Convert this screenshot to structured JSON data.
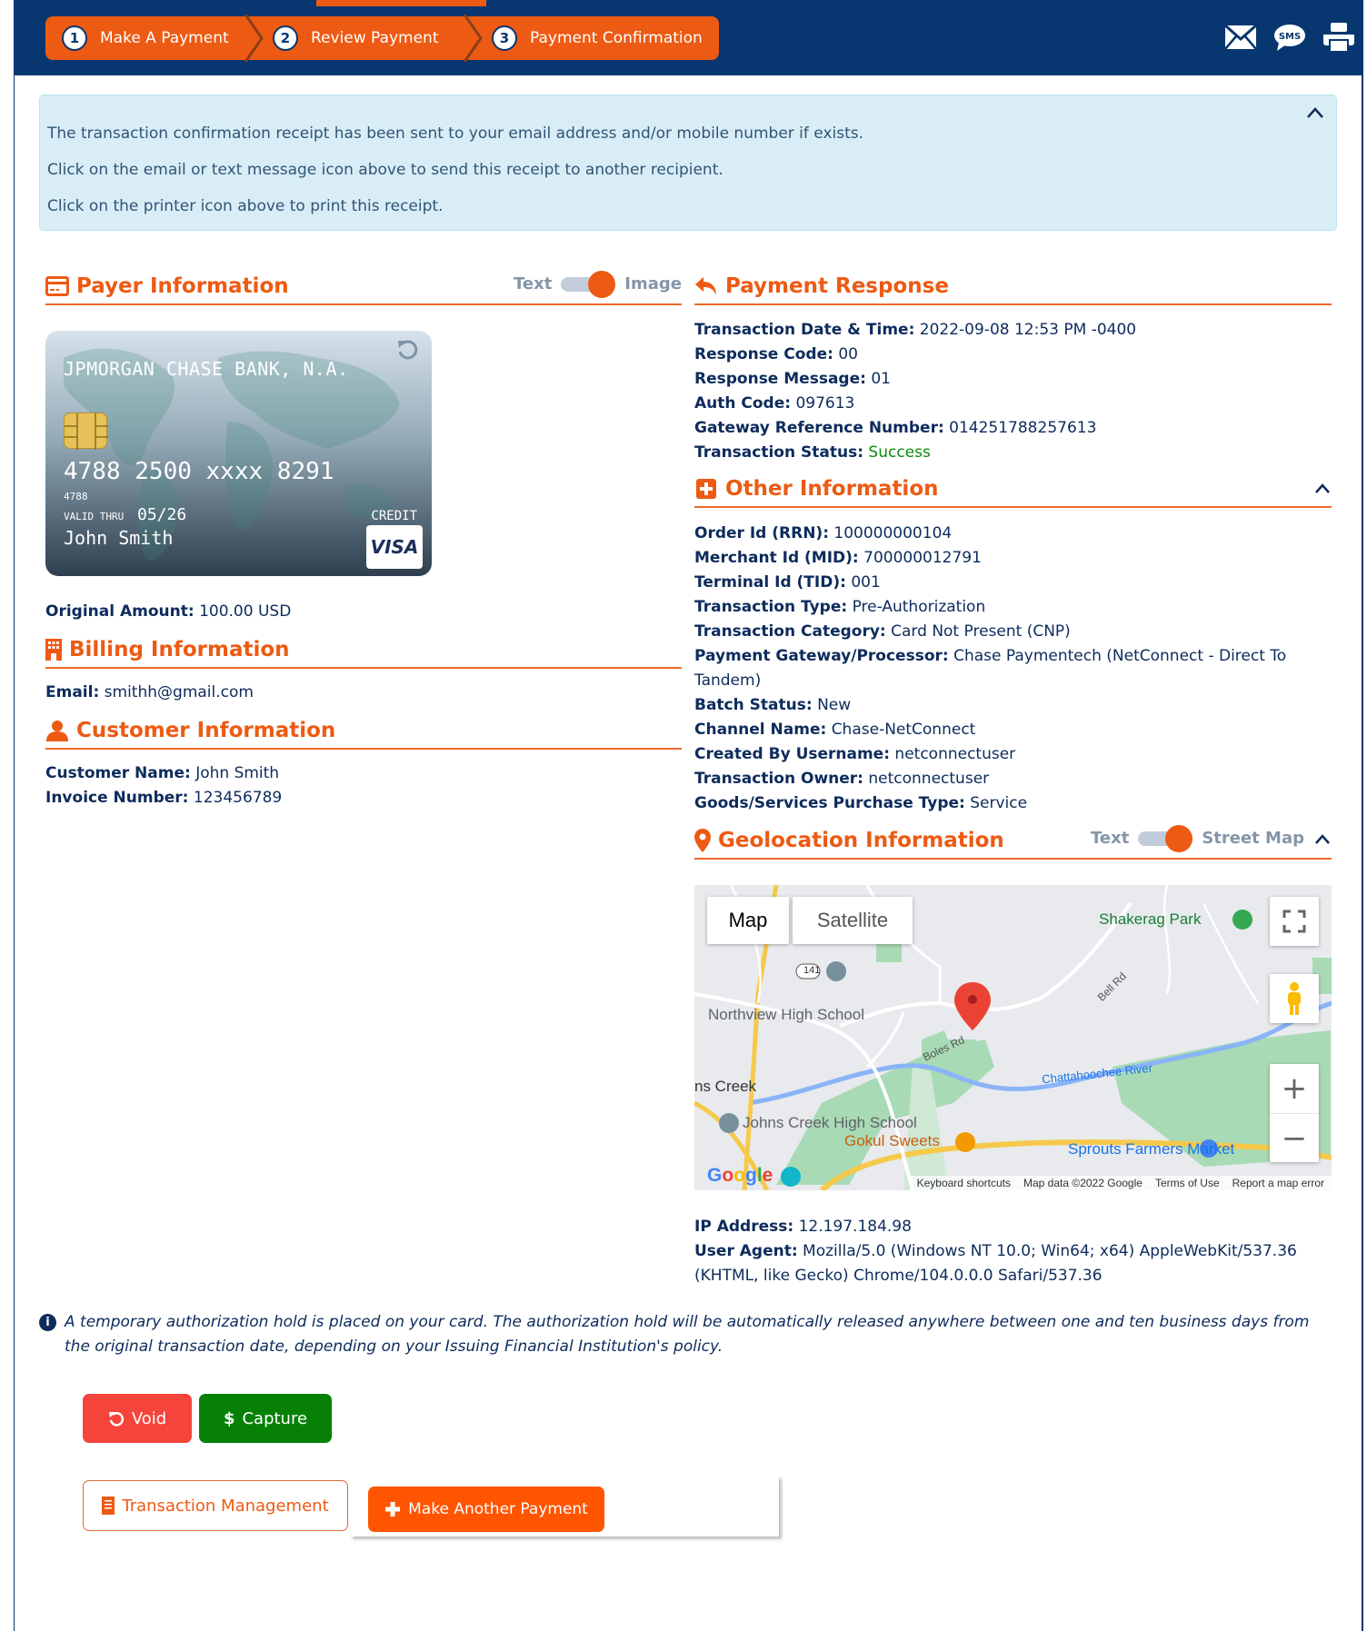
{
  "steps": [
    {
      "num": "1",
      "label": "Make A Payment"
    },
    {
      "num": "2",
      "label": "Review Payment"
    },
    {
      "num": "3",
      "label": "Payment Confirmation"
    }
  ],
  "header_icons": [
    "envelope-icon",
    "sms-icon",
    "printer-icon"
  ],
  "sms_icon_text": "SMS",
  "alert": {
    "line1": "The transaction confirmation receipt has been sent to your email address and/or mobile number if exists.",
    "line2": "Click on the email or text message icon above to send this receipt to another recipient.",
    "line3": "Click on the printer icon above to print this receipt."
  },
  "payer": {
    "title": "Payer Information",
    "toggle_left": "Text",
    "toggle_right": "Image",
    "toggle_state": "Image",
    "card": {
      "bank": "JPMORGAN CHASE BANK, N.A.",
      "number": "4788 2500 xxxx 8291",
      "bin": "4788",
      "valid_label": "VALID THRU",
      "valid": "05/26",
      "holder": "John Smith",
      "type": "CREDIT",
      "brand": "VISA"
    },
    "original_amount_label": "Original Amount:",
    "original_amount": "100.00 USD"
  },
  "billing": {
    "title": "Billing Information",
    "email_label": "Email:",
    "email": "smithh@gmail.com"
  },
  "customer": {
    "title": "Customer Information",
    "fields": [
      {
        "k": "Customer Name:",
        "v": "John Smith"
      },
      {
        "k": "Invoice Number:",
        "v": "123456789"
      }
    ]
  },
  "payment_response": {
    "title": "Payment Response",
    "fields": [
      {
        "k": "Transaction Date & Time:",
        "v": "2022-09-08 12:53 PM -0400"
      },
      {
        "k": "Response Code:",
        "v": "00"
      },
      {
        "k": "Response Message:",
        "v": "01"
      },
      {
        "k": "Auth Code:",
        "v": "097613"
      },
      {
        "k": "Gateway Reference Number:",
        "v": "014251788257613"
      },
      {
        "k": "Transaction Status:",
        "v": "Success"
      }
    ],
    "status_color": "#0a8a0a"
  },
  "other": {
    "title": "Other Information",
    "fields": [
      {
        "k": "Order Id (RRN):",
        "v": "100000000104"
      },
      {
        "k": "Merchant Id (MID):",
        "v": "700000012791"
      },
      {
        "k": "Terminal Id (TID):",
        "v": "001"
      },
      {
        "k": "Transaction Type:",
        "v": "Pre-Authorization"
      },
      {
        "k": "Transaction Category:",
        "v": "Card Not Present (CNP)"
      },
      {
        "k": "Payment Gateway/Processor:",
        "v": "Chase Paymentech (NetConnect - Direct To Tandem)"
      },
      {
        "k": "Batch Status:",
        "v": "New"
      },
      {
        "k": "Channel Name:",
        "v": "Chase-NetConnect"
      },
      {
        "k": "Created By Username:",
        "v": "netconnectuser"
      },
      {
        "k": "Transaction Owner:",
        "v": "netconnectuser"
      },
      {
        "k": "Goods/Services Purchase Type:",
        "v": "Service"
      }
    ]
  },
  "geo": {
    "title": "Geolocation Information",
    "toggle_left": "Text",
    "toggle_right": "Street Map",
    "toggle_state": "Street Map",
    "map": {
      "type_map": "Map",
      "type_satellite": "Satellite",
      "labels": {
        "northview": "Northview High School",
        "johns_creek_hs": "Johns Creek High School",
        "johns_creek": "ns Creek",
        "gokul": "Gokul Sweets",
        "shakerag": "Shakerag Park",
        "sprouts": "Sprouts Farmers Market",
        "river": "Chattahoochee River",
        "bell_rd": "Bell Rd",
        "boles_rd": "Boles Rd",
        "route": "141"
      },
      "google": "Google",
      "footer": [
        "Keyboard shortcuts",
        "Map data ©2022 Google",
        "Terms of Use",
        "Report a map error"
      ]
    },
    "ip_label": "IP Address:",
    "ip": "12.197.184.98",
    "ua_label": "User Agent:",
    "ua": "Mozilla/5.0 (Windows NT 10.0; Win64; x64) AppleWebKit/537.36 (KHTML, like Gecko) Chrome/104.0.0.0 Safari/537.36"
  },
  "notice": "A temporary authorization hold is placed on your card. The authorization hold will be automatically released anywhere between one and ten business days from the original transaction date, depending on your Issuing Financial Institution's policy.",
  "buttons": {
    "void": "Void",
    "capture": "Capture",
    "capture_symbol": "$",
    "transaction_management": "Transaction Management",
    "make_another": "Make Another Payment"
  },
  "colors": {
    "brand_navy": "#083670",
    "accent_orange": "#ed5a13",
    "void_red": "#f5443c",
    "capture_green": "#068106"
  }
}
